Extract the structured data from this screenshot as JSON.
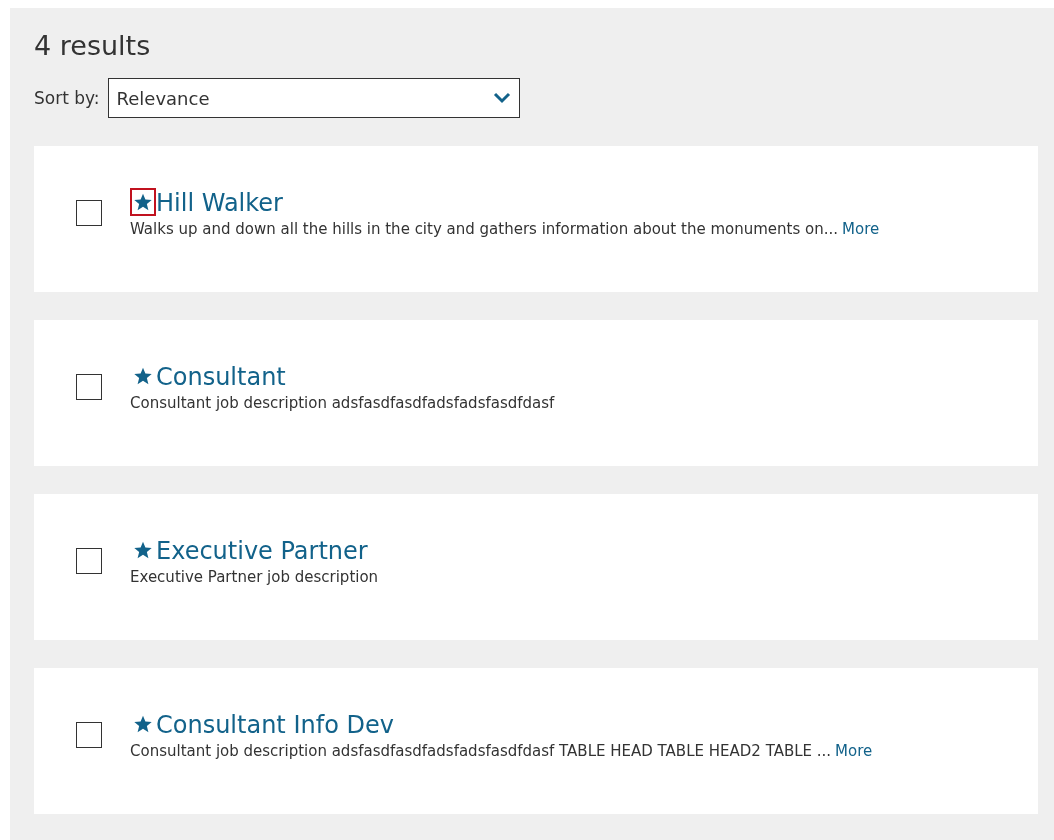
{
  "results_count": "4 results",
  "sort": {
    "label": "Sort by:",
    "value": "Relevance"
  },
  "results": [
    {
      "title": "Hill Walker",
      "description": "Walks up and down all the hills in the city and gathers information about the monuments on...",
      "more": "More",
      "checked": false,
      "star_focused": true
    },
    {
      "title": "Consultant",
      "description": "Consultant job description adsfasdfasdfadsfadsfasdfdasf",
      "checked": false,
      "star_focused": false
    },
    {
      "title": "Executive Partner",
      "description": "Executive Partner job description",
      "checked": false,
      "star_focused": false
    },
    {
      "title": "Consultant Info Dev",
      "description": "Consultant job description adsfasdfasdfadsfadsfasdfdasf TABLE HEAD TABLE HEAD2 TABLE ...",
      "more": "More",
      "checked": false,
      "star_focused": false
    }
  ]
}
